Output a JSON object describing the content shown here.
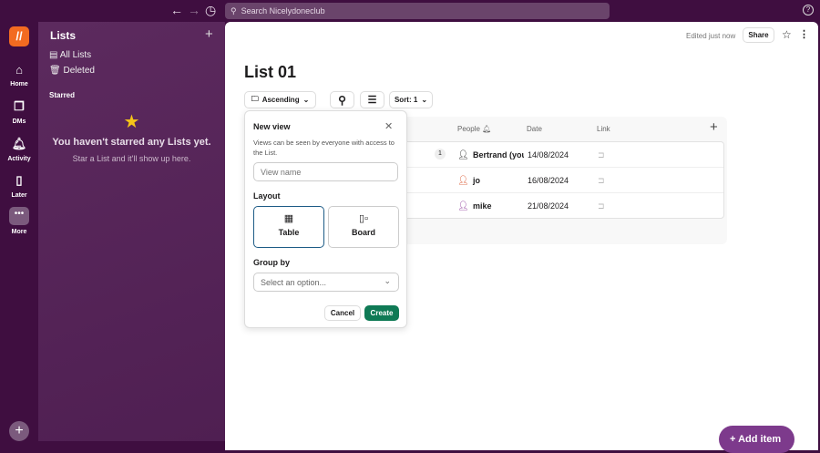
{
  "topbar": {
    "search_placeholder": "Search Nicelydoneclub"
  },
  "rail": [
    {
      "label": "Home",
      "icon": "home-icon"
    },
    {
      "label": "DMs",
      "icon": "dms-icon"
    },
    {
      "label": "Activity",
      "icon": "bell-icon"
    },
    {
      "label": "Later",
      "icon": "bookmark-icon"
    },
    {
      "label": "More",
      "icon": "more-icon"
    }
  ],
  "panel": {
    "title": "Lists",
    "all_lists": "All Lists",
    "deleted": "Deleted",
    "starred": "Starred",
    "empty_title": "You haven't starred any Lists yet.",
    "empty_sub": "Star a List and it'll show up here."
  },
  "header": {
    "edited": "Edited just now",
    "share": "Share"
  },
  "page": {
    "title": "List 01",
    "view_label": "Ascending",
    "sort_label": "Sort: 1"
  },
  "table": {
    "columns": [
      "People",
      "Date",
      "Link"
    ],
    "rows": [
      {
        "badge": "1",
        "person": "Bertrand (you",
        "date": "14/08/2024"
      },
      {
        "person": "jo",
        "date": "16/08/2024"
      },
      {
        "person": "mike",
        "date": "21/08/2024"
      }
    ]
  },
  "popover": {
    "title": "New view",
    "desc": "Views can be seen by everyone with access to the List.",
    "name_placeholder": "View name",
    "layout_label": "Layout",
    "table": "Table",
    "board": "Board",
    "group_label": "Group by",
    "group_placeholder": "Select an option...",
    "cancel": "Cancel",
    "create": "Create"
  },
  "fab": {
    "label": "Add item"
  }
}
